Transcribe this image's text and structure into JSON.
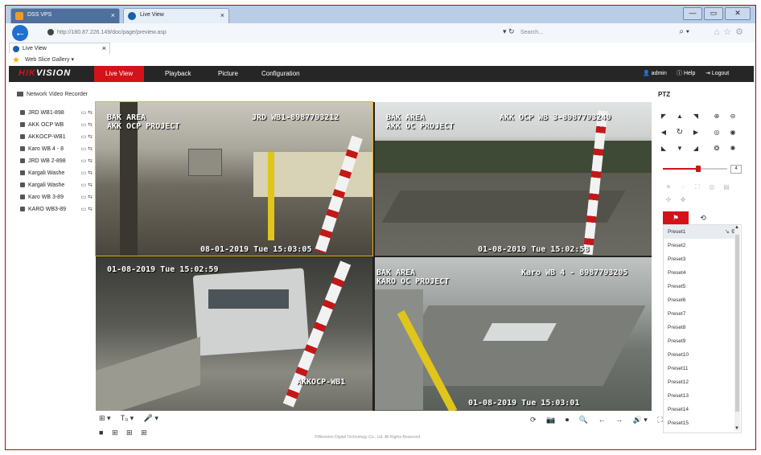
{
  "browser": {
    "tabs": [
      {
        "label": "DSS VPS",
        "close": "×"
      },
      {
        "label": "Live View",
        "close": "×"
      }
    ],
    "window_buttons": [
      "—",
      "▭",
      "✕"
    ],
    "url": "http://180.87.226.149/doc/page/preview.asp",
    "search_placeholder": "Search...",
    "tab2": {
      "label": "Live View",
      "close": "×"
    },
    "favorites": {
      "gallery": "Web Slice Gallery ▾"
    }
  },
  "app": {
    "logo_red": "HIK",
    "logo_white": "VISION",
    "menu": [
      "Live View",
      "Playback",
      "Picture",
      "Configuration"
    ],
    "active_menu": "Live View",
    "user": "admin",
    "help": "Help",
    "logout": "Logout"
  },
  "left_panel": {
    "root": "Network Video Recorder",
    "cameras": [
      "JRD WB1-898",
      "AKK OCP WB",
      "AKKOCP-WB1",
      "Karo WB 4 - 8",
      "JRD WB 2-898",
      "Kargali Washe",
      "Kargali Washe",
      "Karo WB 3-89",
      "KARO WB3-89"
    ]
  },
  "video": {
    "tiles": [
      {
        "top_left": "BAK AREA\nAKK OCP PROJECT",
        "top_right": "JRD WB1-8987793212",
        "bottom": "08-01-2019 Tue 15:03:05"
      },
      {
        "top_left": "BAK AREA\nAKK OC PROJECT",
        "top_right": "AKK OCP WB 3-8987793240",
        "bottom": "01-08-2019 Tue 15:02:58"
      },
      {
        "top_left": "01-08-2019 Tue 15:02:59",
        "top_right": "",
        "bottom": "AKKOCP-WB1"
      },
      {
        "top_left": "BAK AREA\nKARO OC PROJECT",
        "top_right": "Karo WB 4 - 8987793205",
        "bottom": "01-08-2019 Tue 15:03:01"
      }
    ]
  },
  "toolbar": {
    "left_icons": [
      "⊞ ▾",
      "T₀ ▾",
      "🎤 ▾"
    ],
    "layout_icons": [
      "■",
      "⊞",
      "⊞",
      "⊞"
    ],
    "right_icons": [
      "⟳",
      "📷",
      "⏺",
      "🔍",
      "←",
      "→",
      "🔊 ▾",
      "⛶"
    ]
  },
  "copyright": "©Hikvision Digital Technology Co., Ltd. All Rights Reserved.",
  "ptz": {
    "title": "PTZ",
    "speed": "4",
    "speed_level": 0.55,
    "tabs": [
      "⚑",
      "⟲"
    ],
    "presets": [
      "Preset1",
      "Preset2",
      "Preset3",
      "Preset4",
      "Preset5",
      "Preset6",
      "Preset7",
      "Preset8",
      "Preset9",
      "Preset10",
      "Preset11",
      "Preset12",
      "Preset13",
      "Preset14",
      "Preset15"
    ],
    "preset_ops": "↘ ⚙"
  }
}
